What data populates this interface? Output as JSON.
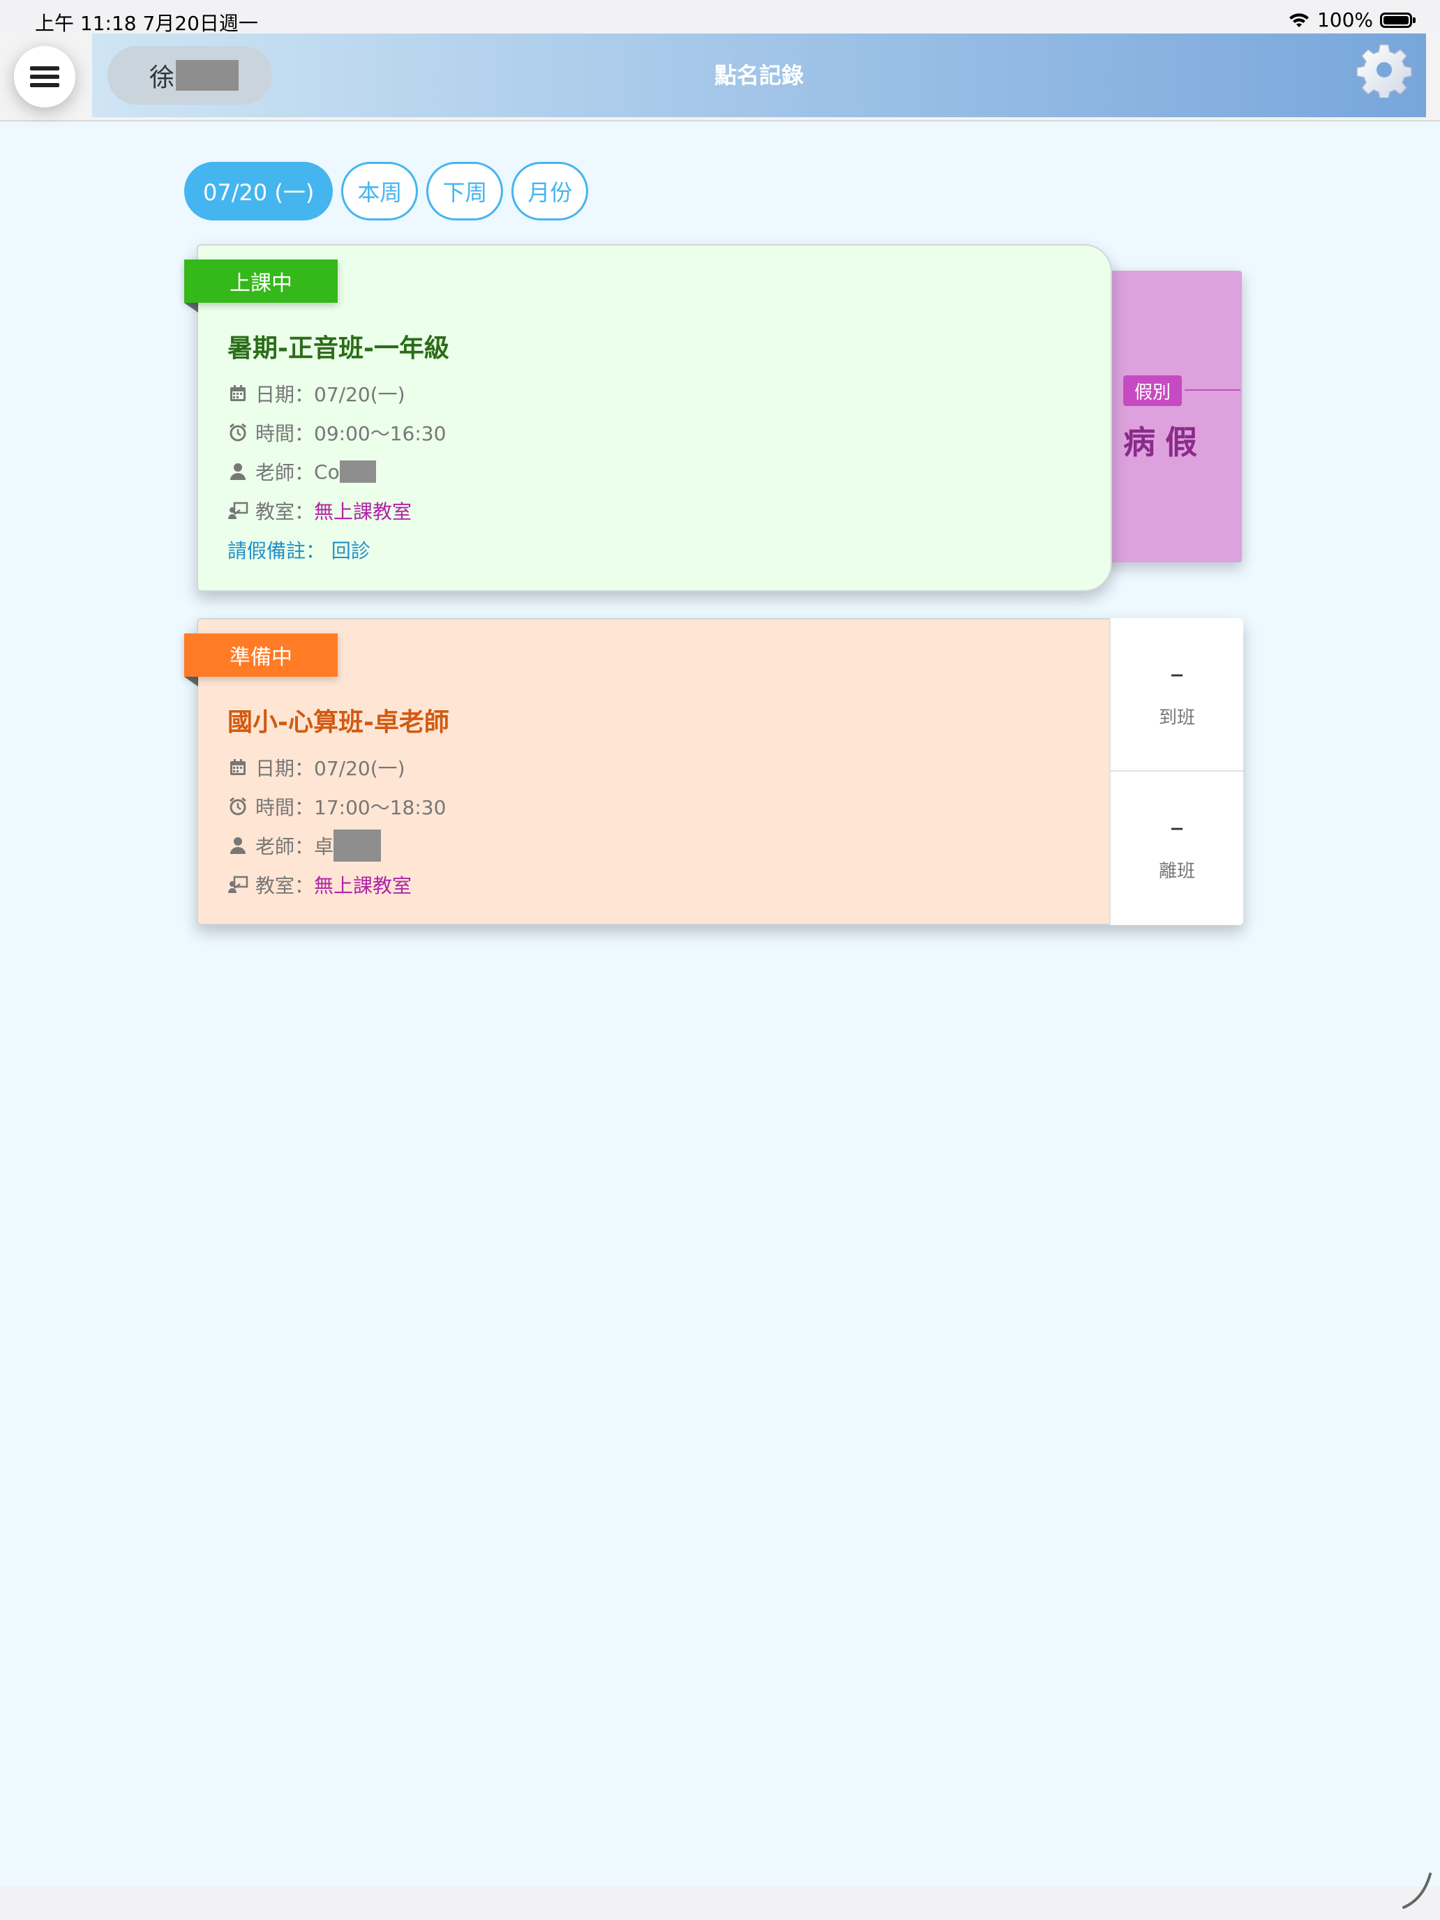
{
  "status_bar": {
    "time": "上午 11:18   7月20日週一",
    "battery": "100%"
  },
  "header": {
    "user_name": "徐",
    "title": "點名記錄"
  },
  "filters": [
    {
      "label": "07/20 (一)",
      "active": true
    },
    {
      "label": "本周",
      "active": false
    },
    {
      "label": "下周",
      "active": false
    },
    {
      "label": "月份",
      "active": false
    }
  ],
  "cards": [
    {
      "status": "上課中",
      "course": "暑期-正音班-一年級",
      "date_label": "日期：",
      "date": "07/20(一)",
      "time_label": "時間：",
      "time": "09:00～16:30",
      "teacher_label": "老師：",
      "teacher": "Co",
      "room_label": "教室：",
      "room": "無上課教室",
      "note_label": "請假備註：",
      "note": "回診",
      "leave": {
        "tag": "假別",
        "type": "病假"
      }
    },
    {
      "status": "準備中",
      "course": "國小-心算班-卓老師",
      "date_label": "日期：",
      "date": "07/20(一)",
      "time_label": "時間：",
      "time": "17:00～18:30",
      "teacher_label": "老師：",
      "teacher": "卓",
      "room_label": "教室：",
      "room": "無上課教室",
      "attendance": [
        {
          "value": "–",
          "label": "到班"
        },
        {
          "value": "–",
          "label": "離班"
        }
      ]
    }
  ],
  "colors": {
    "accent": "#45b5ef",
    "in_class": "#35b81a",
    "preparing": "#ff7b25",
    "leave": "#c64bc2"
  }
}
